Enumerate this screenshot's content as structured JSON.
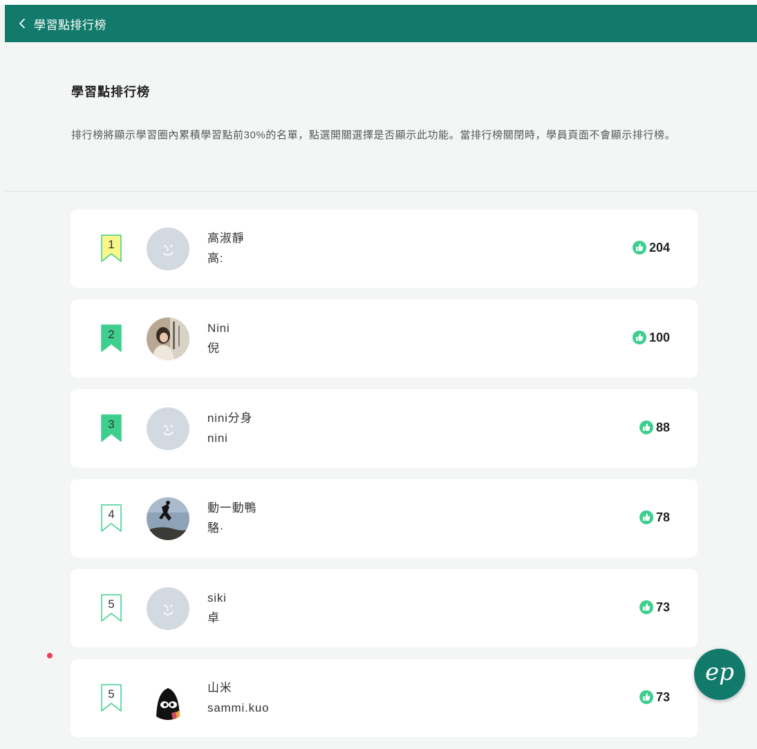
{
  "header": {
    "back_icon": "chevron-left-icon",
    "title": "學習點排行榜"
  },
  "intro": {
    "title": "學習點排行榜",
    "description": "排行榜將顯示學習圈內累積學習點前30%的名單，點選開關選擇是否顯示此功能。當排行榜關閉時，學員頁面不會顯示排行榜。"
  },
  "colors": {
    "header_bg": "#127a6b",
    "rank1_badge": "#f9f68a",
    "rank2_badge": "#3ecf8e",
    "rank3_badge": "#3ecf8e",
    "badge_outline": "#3ecf8e",
    "points_icon": "#3ecf8e",
    "notification_dot": "#e8405a"
  },
  "leaderboard": [
    {
      "rank": "1",
      "nickname": "高淑靜",
      "realname": "高:",
      "points": "204",
      "avatar": "default-face-avatar",
      "badge_style": "yellow-filled"
    },
    {
      "rank": "2",
      "nickname": "Nini",
      "realname": "倪",
      "points": "100",
      "avatar": "photo-avatar-person",
      "badge_style": "green-filled"
    },
    {
      "rank": "3",
      "nickname": "nini分身",
      "realname": "nini",
      "points": "88",
      "avatar": "default-face-avatar",
      "badge_style": "green-filled"
    },
    {
      "rank": "4",
      "nickname": "動一動鴨",
      "realname": "駱·",
      "points": "78",
      "avatar": "photo-avatar-jumping",
      "badge_style": "outline"
    },
    {
      "rank": "5",
      "nickname": "siki",
      "realname": "卓",
      "points": "73",
      "avatar": "default-face-avatar",
      "badge_style": "outline"
    },
    {
      "rank": "5",
      "nickname": "山米",
      "realname": "sammi.kuo",
      "points": "73",
      "avatar": "photo-avatar-penguin",
      "badge_style": "outline"
    }
  ],
  "fab": {
    "label": "ep",
    "icon": "ep-logo-icon"
  }
}
